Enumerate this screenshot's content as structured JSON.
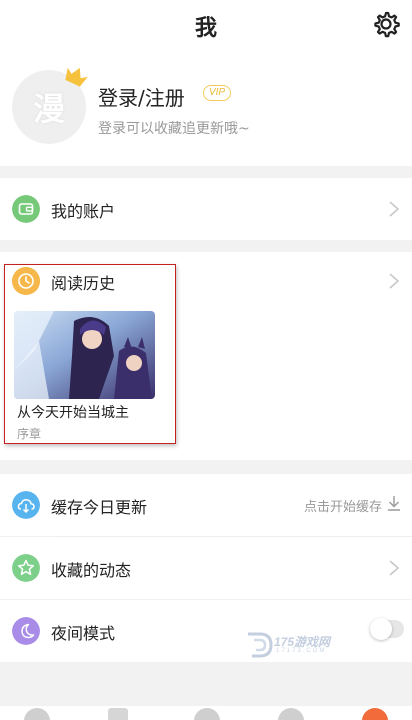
{
  "header": {
    "title": "我",
    "settings_icon": "gear-icon"
  },
  "profile": {
    "avatar_char": "漫",
    "login_label": "登录/注册",
    "vip_badge": "VIP",
    "login_hint": "登录可以收藏追更新哦~"
  },
  "menu": {
    "account": {
      "label": "我的账户",
      "icon": "wallet-icon",
      "color": "#77c97a"
    },
    "history": {
      "label": "阅读历史",
      "icon": "clock-icon",
      "color": "#f6b84a",
      "item": {
        "title": "从今天开始当城主",
        "chapter": "序章"
      }
    },
    "cache": {
      "label": "缓存今日更新",
      "action": "点击开始缓存",
      "icon": "cloud-download-icon",
      "color": "#58b4ef"
    },
    "favorites": {
      "label": "收藏的动态",
      "icon": "star-icon",
      "color": "#7dd08a"
    },
    "night": {
      "label": "夜间模式",
      "icon": "moon-icon",
      "color": "#a98be8",
      "enabled": false
    }
  },
  "watermark": {
    "text": "175游戏网",
    "sub": "17173.COM"
  },
  "colors": {
    "highlight_border": "#c42121",
    "accent_vip": "#e9bc33"
  }
}
